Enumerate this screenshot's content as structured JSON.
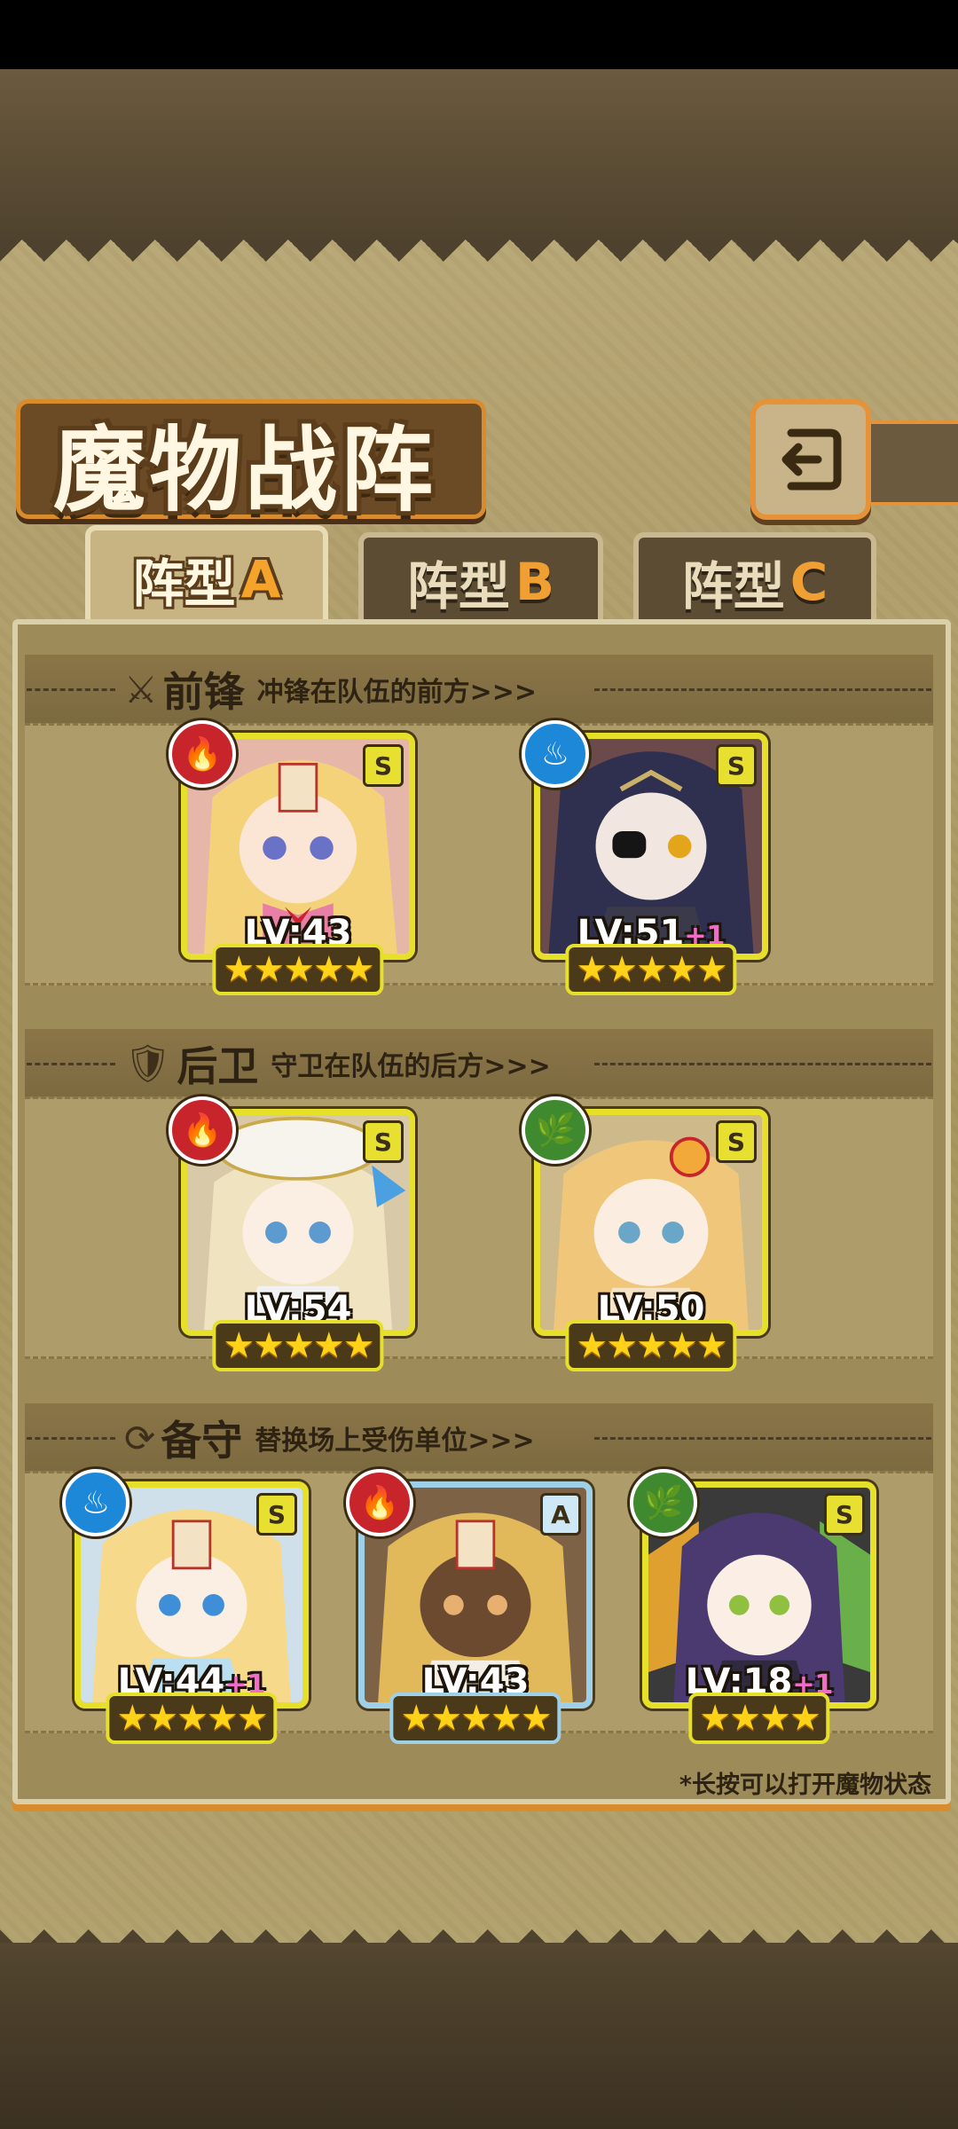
{
  "title": "魔物战阵",
  "tabs": [
    {
      "label": "阵型",
      "suffix": "A",
      "active": true
    },
    {
      "label": "阵型",
      "suffix": "B",
      "active": false
    },
    {
      "label": "阵型",
      "suffix": "C",
      "active": false
    }
  ],
  "sections": {
    "vanguard": {
      "title": "前锋",
      "desc": "冲锋在队伍的前方>>>",
      "icon": "sword-icon"
    },
    "rearguard": {
      "title": "后卫",
      "desc": "守卫在队伍的后方>>>",
      "icon": "shield-icon"
    },
    "reserve": {
      "title": "备守",
      "desc": "替换场上受伤单位>>>",
      "icon": "swap-icon"
    }
  },
  "units": {
    "vanguard": [
      {
        "level": "LV:43",
        "plus": "",
        "rank": "S",
        "element": "fire",
        "stars": 5
      },
      {
        "level": "LV:51",
        "plus": "+1",
        "rank": "S",
        "element": "water",
        "stars": 5
      }
    ],
    "rearguard": [
      {
        "level": "LV:54",
        "plus": "",
        "rank": "S",
        "element": "fire",
        "stars": 5
      },
      {
        "level": "LV:50",
        "plus": "",
        "rank": "S",
        "element": "wood",
        "stars": 5
      }
    ],
    "reserve": [
      {
        "level": "LV:44",
        "plus": "+1",
        "rank": "S",
        "element": "water",
        "stars": 5
      },
      {
        "level": "LV:43",
        "plus": "",
        "rank": "A",
        "element": "fire",
        "stars": 5
      },
      {
        "level": "LV:18",
        "plus": "+1",
        "rank": "S",
        "element": "wood",
        "stars": 4
      }
    ]
  },
  "footnote": "*长按可以打开魔物状态",
  "colors": {
    "accent": "#d98c2e",
    "frame_s": "#e6e02a",
    "frame_a": "#9ed0ea",
    "fire": "#c8242c",
    "water": "#1e88d8",
    "wood": "#3f8a2e"
  }
}
